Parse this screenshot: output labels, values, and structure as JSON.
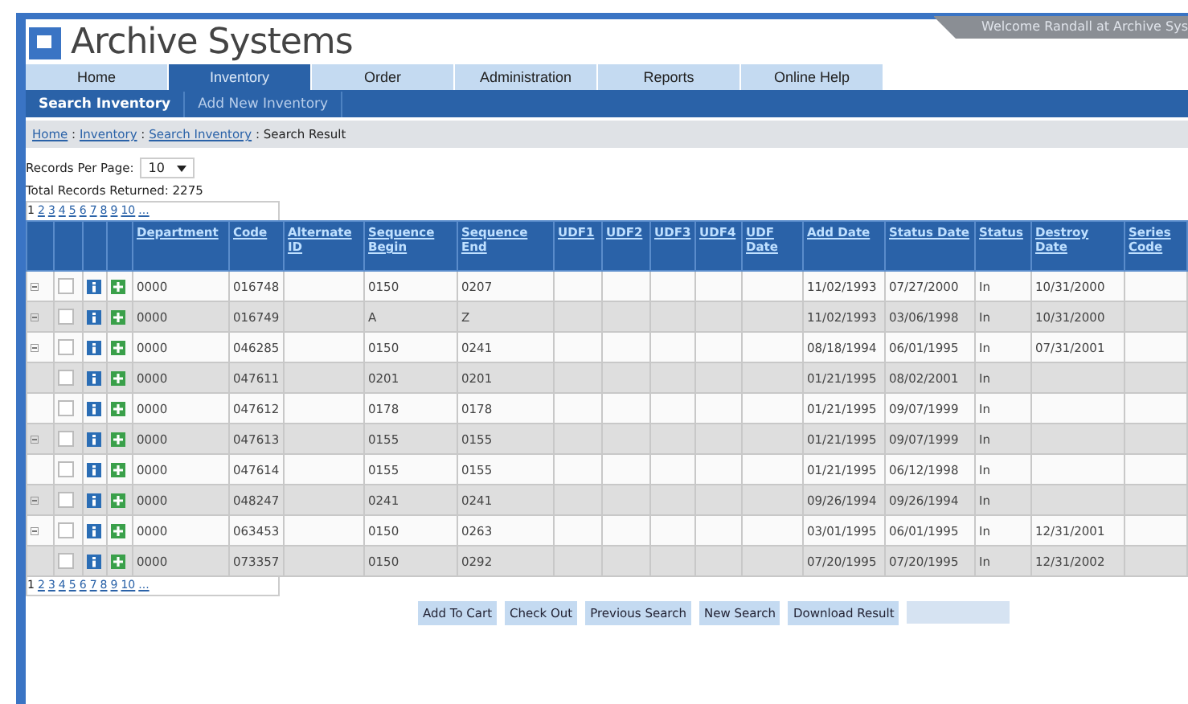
{
  "header": {
    "title": "Archive Systems",
    "welcome": "Welcome Randall at Archive Sys"
  },
  "tabs": [
    {
      "label": "Home",
      "selected": false
    },
    {
      "label": "Inventory",
      "selected": true
    },
    {
      "label": "Order",
      "selected": false
    },
    {
      "label": "Administration",
      "selected": false
    },
    {
      "label": "Reports",
      "selected": false
    },
    {
      "label": "Online Help",
      "selected": false
    }
  ],
  "subtabs": [
    {
      "label": "Search Inventory",
      "selected": true
    },
    {
      "label": "Add New Inventory",
      "selected": false
    }
  ],
  "breadcrumb": {
    "links": [
      "Home",
      "Inventory",
      "Search Inventory"
    ],
    "current": "Search Result",
    "separator": ":"
  },
  "records_per_page": {
    "label": "Records Per Page:",
    "value": "10"
  },
  "total": "Total Records Returned: 2275",
  "pages_top": [
    {
      "label": "1",
      "selected": true
    },
    {
      "label": "2",
      "selected": false
    },
    {
      "label": "3",
      "selected": false
    },
    {
      "label": "4",
      "selected": false
    },
    {
      "label": "5",
      "selected": false
    },
    {
      "label": "6",
      "selected": false
    },
    {
      "label": "7",
      "selected": false
    },
    {
      "label": "8",
      "selected": false
    },
    {
      "label": "9",
      "selected": false
    },
    {
      "label": "10",
      "selected": false
    },
    {
      "label": "...",
      "selected": false
    }
  ],
  "pages_bottom": [
    {
      "label": "1",
      "selected": true
    },
    {
      "label": "2",
      "selected": false
    },
    {
      "label": "3",
      "selected": false
    },
    {
      "label": "4",
      "selected": false
    },
    {
      "label": "5",
      "selected": false
    },
    {
      "label": "6",
      "selected": false
    },
    {
      "label": "7",
      "selected": false
    },
    {
      "label": "8",
      "selected": false
    },
    {
      "label": "9",
      "selected": false
    },
    {
      "label": "10",
      "selected": false
    },
    {
      "label": "...",
      "selected": false
    }
  ],
  "table": {
    "columns": [
      "Department",
      "Code",
      "Alternate ID",
      "Sequence Begin",
      "Sequence End",
      "UDF1",
      "UDF2",
      "UDF3",
      "UDF4",
      "UDF Date",
      "Add Date",
      "Status Date",
      "Status",
      "Destroy Date",
      "Series Code"
    ],
    "rows": [
      {
        "expander": true,
        "checked": false,
        "cells": [
          "0000",
          "016748",
          "",
          "0150",
          "0207",
          "",
          "",
          "",
          "",
          "",
          "11/02/1993",
          "07/27/2000",
          "In",
          "10/31/2000",
          ""
        ]
      },
      {
        "expander": true,
        "checked": false,
        "cells": [
          "0000",
          "016749",
          "",
          "A",
          "Z",
          "",
          "",
          "",
          "",
          "",
          "11/02/1993",
          "03/06/1998",
          "In",
          "10/31/2000",
          ""
        ]
      },
      {
        "expander": true,
        "checked": false,
        "cells": [
          "0000",
          "046285",
          "",
          "0150",
          "0241",
          "",
          "",
          "",
          "",
          "",
          "08/18/1994",
          "06/01/1995",
          "In",
          "07/31/2001",
          ""
        ]
      },
      {
        "expander": false,
        "checked": false,
        "cells": [
          "0000",
          "047611",
          "",
          "0201",
          "0201",
          "",
          "",
          "",
          "",
          "",
          "01/21/1995",
          "08/02/2001",
          "In",
          "",
          ""
        ]
      },
      {
        "expander": false,
        "checked": false,
        "cells": [
          "0000",
          "047612",
          "",
          "0178",
          "0178",
          "",
          "",
          "",
          "",
          "",
          "01/21/1995",
          "09/07/1999",
          "In",
          "",
          ""
        ]
      },
      {
        "expander": true,
        "checked": false,
        "cells": [
          "0000",
          "047613",
          "",
          "0155",
          "0155",
          "",
          "",
          "",
          "",
          "",
          "01/21/1995",
          "09/07/1999",
          "In",
          "",
          ""
        ]
      },
      {
        "expander": false,
        "checked": false,
        "cells": [
          "0000",
          "047614",
          "",
          "0155",
          "0155",
          "",
          "",
          "",
          "",
          "",
          "01/21/1995",
          "06/12/1998",
          "In",
          "",
          ""
        ]
      },
      {
        "expander": true,
        "checked": false,
        "cells": [
          "0000",
          "048247",
          "",
          "0241",
          "0241",
          "",
          "",
          "",
          "",
          "",
          "09/26/1994",
          "09/26/1994",
          "In",
          "",
          ""
        ]
      },
      {
        "expander": true,
        "checked": false,
        "cells": [
          "0000",
          "063453",
          "",
          "0150",
          "0263",
          "",
          "",
          "",
          "",
          "",
          "03/01/1995",
          "06/01/1995",
          "In",
          "12/31/2001",
          ""
        ]
      },
      {
        "expander": false,
        "checked": false,
        "cells": [
          "0000",
          "073357",
          "",
          "0150",
          "0292",
          "",
          "",
          "",
          "",
          "",
          "07/20/1995",
          "07/20/1995",
          "In",
          "12/31/2002",
          ""
        ]
      }
    ]
  },
  "buttons": [
    {
      "label": "Add To Cart",
      "disabled": false
    },
    {
      "label": "Check Out",
      "disabled": false
    },
    {
      "label": "Previous Search",
      "disabled": false
    },
    {
      "label": "New Search",
      "disabled": false
    },
    {
      "label": "Download Result",
      "disabled": false
    },
    {
      "disabled": true
    }
  ]
}
